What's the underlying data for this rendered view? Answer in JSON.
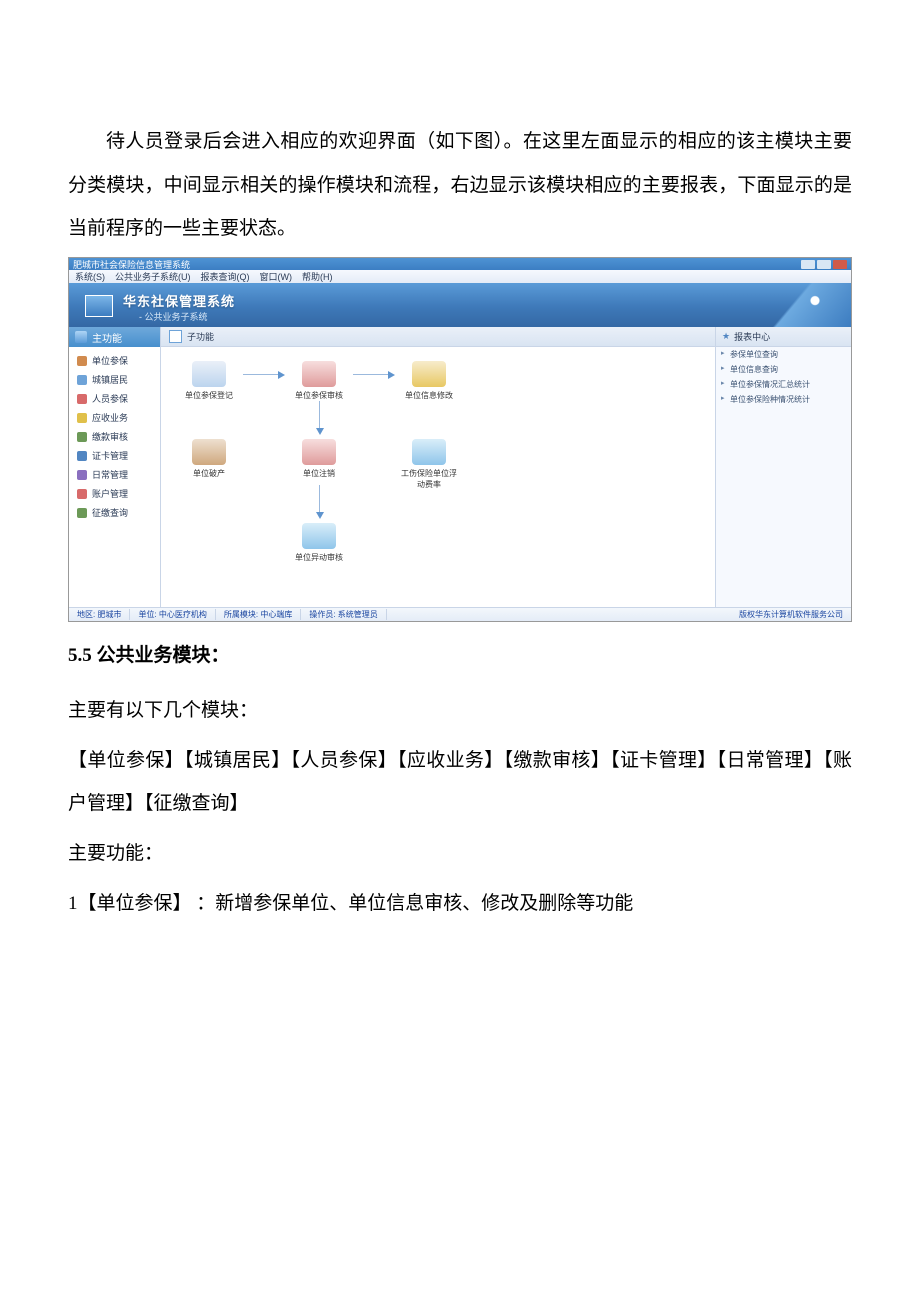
{
  "para1": "待人员登录后会进入相应的欢迎界面（如下图）。在这里左面显示的相应的该主模块主要分类模块，中间显示相关的操作模块和流程，右边显示该模块相应的主要报表，下面显示的是当前程序的一些主要状态。",
  "sectionTitle": "5.5 公共业务模块：",
  "para2": "主要有以下几个模块：",
  "para3": "【单位参保】【城镇居民】【人员参保】【应收业务】【缴款审核】【证卡管理】【日常管理】【账户管理】【征缴查询】",
  "para4": "主要功能：",
  "para5": "1【单位参保】 ：新增参保单位、单位信息审核、修改及删除等功能",
  "screenshot": {
    "windowTitle": "肥城市社会保险信息管理系统",
    "menu": [
      "系统(S)",
      "公共业务子系统(U)",
      "报表查询(Q)",
      "窗口(W)",
      "帮助(H)"
    ],
    "appName": "华东社保管理系统",
    "subTitle": "- 公共业务子系统",
    "sidebarHeader": "主功能",
    "sidebar": [
      "单位参保",
      "城镇居民",
      "人员参保",
      "应收业务",
      "缴款审核",
      "证卡管理",
      "日常管理",
      "账户管理",
      "征缴查询"
    ],
    "mainHeader": "子功能",
    "nodes": [
      {
        "label": "单位参保登记"
      },
      {
        "label": "单位参保审核"
      },
      {
        "label": "单位信息修改"
      },
      {
        "label": "单位破产"
      },
      {
        "label": "单位注销"
      },
      {
        "label": "工伤保险单位浮动费率"
      },
      {
        "label": "单位异动审核"
      }
    ],
    "reportHeader": "报表中心",
    "reports": [
      "参保单位查询",
      "单位信息查询",
      "单位参保情况汇总统计",
      "单位参保险种情况统计"
    ],
    "status": {
      "region": "地区: 肥城市",
      "unit": "单位: 中心医疗机构",
      "module": "所属模块: 中心端库",
      "operator": "操作员: 系统管理员",
      "copyright": "版权华东计算机软件服务公司"
    }
  }
}
